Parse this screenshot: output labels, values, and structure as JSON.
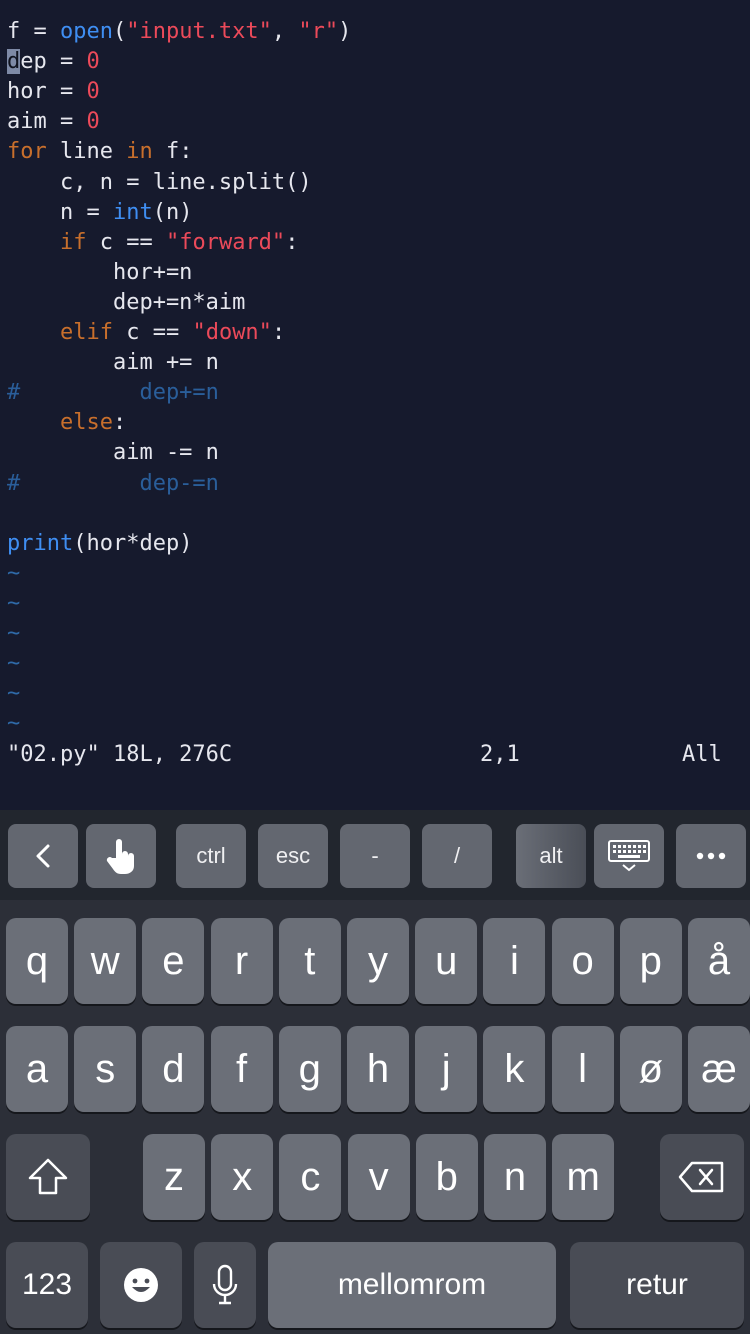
{
  "editor": {
    "lines": [
      {
        "tokens": [
          {
            "t": "f = ",
            "c": "var"
          },
          {
            "t": "open",
            "c": "fn"
          },
          {
            "t": "(",
            "c": "var"
          },
          {
            "t": "\"input.txt\"",
            "c": "str"
          },
          {
            "t": ", ",
            "c": "var"
          },
          {
            "t": "\"r\"",
            "c": "str"
          },
          {
            "t": ")",
            "c": "var"
          }
        ]
      },
      {
        "tokens": [
          {
            "t": "d",
            "c": "cursor"
          },
          {
            "t": "ep = ",
            "c": "var"
          },
          {
            "t": "0",
            "c": "num"
          }
        ]
      },
      {
        "tokens": [
          {
            "t": "hor = ",
            "c": "var"
          },
          {
            "t": "0",
            "c": "num"
          }
        ]
      },
      {
        "tokens": [
          {
            "t": "aim = ",
            "c": "var"
          },
          {
            "t": "0",
            "c": "num"
          }
        ]
      },
      {
        "tokens": [
          {
            "t": "for",
            "c": "kw"
          },
          {
            "t": " line ",
            "c": "var"
          },
          {
            "t": "in",
            "c": "kw"
          },
          {
            "t": " f:",
            "c": "var"
          }
        ]
      },
      {
        "tokens": [
          {
            "t": "    c, n = line.split()",
            "c": "var"
          }
        ]
      },
      {
        "tokens": [
          {
            "t": "    n = ",
            "c": "var"
          },
          {
            "t": "int",
            "c": "fn"
          },
          {
            "t": "(n)",
            "c": "var"
          }
        ]
      },
      {
        "tokens": [
          {
            "t": "    ",
            "c": "var"
          },
          {
            "t": "if",
            "c": "kw"
          },
          {
            "t": " c == ",
            "c": "var"
          },
          {
            "t": "\"forward\"",
            "c": "str"
          },
          {
            "t": ":",
            "c": "var"
          }
        ]
      },
      {
        "tokens": [
          {
            "t": "        hor+=n",
            "c": "var"
          }
        ]
      },
      {
        "tokens": [
          {
            "t": "        dep+=n*aim",
            "c": "var"
          }
        ]
      },
      {
        "tokens": [
          {
            "t": "    ",
            "c": "var"
          },
          {
            "t": "elif",
            "c": "kw"
          },
          {
            "t": " c == ",
            "c": "var"
          },
          {
            "t": "\"down\"",
            "c": "str"
          },
          {
            "t": ":",
            "c": "var"
          }
        ]
      },
      {
        "tokens": [
          {
            "t": "        aim += n",
            "c": "var"
          }
        ]
      },
      {
        "tokens": [
          {
            "t": "#         dep+=n",
            "c": "cm"
          }
        ]
      },
      {
        "tokens": [
          {
            "t": "    ",
            "c": "var"
          },
          {
            "t": "else",
            "c": "kw"
          },
          {
            "t": ":",
            "c": "var"
          }
        ]
      },
      {
        "tokens": [
          {
            "t": "        aim -= n",
            "c": "var"
          }
        ]
      },
      {
        "tokens": [
          {
            "t": "#         dep-=n",
            "c": "cm"
          }
        ]
      },
      {
        "tokens": []
      },
      {
        "tokens": [
          {
            "t": "print",
            "c": "fn"
          },
          {
            "t": "(hor*dep)",
            "c": "var"
          }
        ]
      },
      {
        "tokens": [
          {
            "t": "~",
            "c": "tilde"
          }
        ]
      },
      {
        "tokens": [
          {
            "t": "~",
            "c": "tilde"
          }
        ]
      },
      {
        "tokens": [
          {
            "t": "~",
            "c": "tilde"
          }
        ]
      },
      {
        "tokens": [
          {
            "t": "~",
            "c": "tilde"
          }
        ]
      },
      {
        "tokens": [
          {
            "t": "~",
            "c": "tilde"
          }
        ]
      },
      {
        "tokens": [
          {
            "t": "~",
            "c": "tilde"
          }
        ]
      }
    ],
    "status": {
      "file": "\"02.py\" 18L, 276C",
      "position": "2,1",
      "scroll": "All"
    }
  },
  "toolbar": {
    "back_icon": "chevron-left-icon",
    "touch_icon": "hand-pointer-icon",
    "ctrl": "ctrl",
    "esc": "esc",
    "dash": "-",
    "slash": "/",
    "alt": "alt",
    "hide_keyboard_icon": "keyboard-hide-icon",
    "more_icon": "ellipsis-icon"
  },
  "keyboard": {
    "row1": [
      "q",
      "w",
      "e",
      "r",
      "t",
      "y",
      "u",
      "i",
      "o",
      "p",
      "å"
    ],
    "row2": [
      "a",
      "s",
      "d",
      "f",
      "g",
      "h",
      "j",
      "k",
      "l",
      "ø",
      "æ"
    ],
    "row3": [
      "z",
      "x",
      "c",
      "v",
      "b",
      "n",
      "m"
    ],
    "numbers": "123",
    "space": "mellomrom",
    "return": "retur",
    "shift_icon": "shift-icon",
    "backspace_icon": "backspace-icon",
    "emoji_icon": "emoji-icon",
    "mic_icon": "microphone-icon"
  },
  "colors": {
    "background": "#161a2d",
    "keyword": "#c86f2c",
    "string": "#ec4a5a",
    "function": "#3f8ef2",
    "comment": "#2a5e9a"
  }
}
